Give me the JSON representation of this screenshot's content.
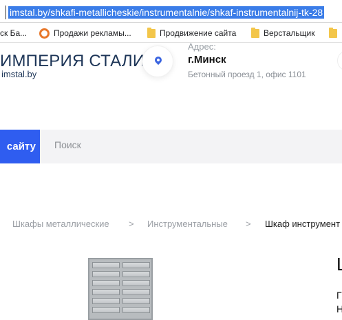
{
  "browser": {
    "url": "imstal.by/shkafi-metallicheskie/instrumentalnie/shkaf-instrumentalnij-tk-28",
    "bookmarks": [
      {
        "label": "ск Ба...",
        "icon": "none"
      },
      {
        "label": "Продажи рекламы...",
        "icon": "ring-icon"
      },
      {
        "label": "Продвижение сайта",
        "icon": "folder-icon"
      },
      {
        "label": "Верстальщик",
        "icon": "folder-icon"
      },
      {
        "label": "",
        "icon": "folder-icon"
      }
    ]
  },
  "header": {
    "logo_name": "ИМПЕРИЯ СТАЛИ",
    "logo_domain": "imstal.by",
    "address_label": "Адрес:",
    "city": "г.Минск",
    "street": "Бетонный проезд 1, офис 1101"
  },
  "search": {
    "button_label": "сайту",
    "placeholder": "Поиск"
  },
  "breadcrumbs": [
    "Шкафы металлические",
    ">",
    "Инструментальные",
    ">",
    "Шкаф инструмент"
  ],
  "product": {
    "title_fragment": "Ш",
    "line1_fragment": "Г",
    "line2_fragment": "Н"
  },
  "colors": {
    "accent": "#2f5df0",
    "url_highlight": "#3b7de8",
    "logo": "#1d3557"
  }
}
